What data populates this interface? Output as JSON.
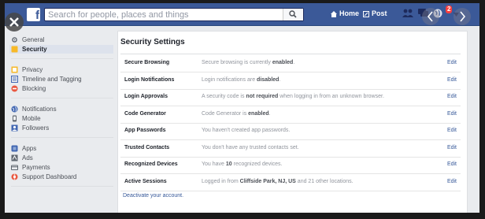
{
  "topbar": {
    "logo": "f",
    "search_placeholder": "Search for people, places and things",
    "home_label": "Home",
    "post_label": "Post",
    "notif_count": "2"
  },
  "sidebar": {
    "groups": [
      [
        {
          "label": "General",
          "icon": "gear-icon"
        },
        {
          "label": "Security",
          "icon": "shield-icon",
          "active": true
        }
      ],
      [
        {
          "label": "Privacy",
          "icon": "privacy-icon"
        },
        {
          "label": "Timeline and Tagging",
          "icon": "timeline-icon"
        },
        {
          "label": "Blocking",
          "icon": "block-icon"
        }
      ],
      [
        {
          "label": "Notifications",
          "icon": "globe-icon"
        },
        {
          "label": "Mobile",
          "icon": "mobile-icon"
        },
        {
          "label": "Followers",
          "icon": "followers-icon"
        }
      ],
      [
        {
          "label": "Apps",
          "icon": "apps-icon"
        },
        {
          "label": "Ads",
          "icon": "ads-icon"
        },
        {
          "label": "Payments",
          "icon": "payments-icon"
        },
        {
          "label": "Support Dashboard",
          "icon": "support-icon"
        }
      ]
    ]
  },
  "main": {
    "title": "Security Settings",
    "rows": [
      {
        "label": "Secure Browsing",
        "desc": [
          [
            "Secure browsing is currently ",
            false
          ],
          [
            "enabled",
            true
          ],
          [
            ".",
            false
          ]
        ],
        "edit": "Edit"
      },
      {
        "label": "Login Notifications",
        "desc": [
          [
            "Login notifications are ",
            false
          ],
          [
            "disabled",
            true
          ],
          [
            ".",
            false
          ]
        ],
        "edit": "Edit"
      },
      {
        "label": "Login Approvals",
        "desc": [
          [
            "A security code is ",
            false
          ],
          [
            "not required",
            true
          ],
          [
            " when logging in from an unknown browser.",
            false
          ]
        ],
        "edit": "Edit"
      },
      {
        "label": "Code Generator",
        "desc": [
          [
            "Code Generator is ",
            false
          ],
          [
            "enabled",
            true
          ],
          [
            ".",
            false
          ]
        ],
        "edit": "Edit"
      },
      {
        "label": "App Passwords",
        "desc": [
          [
            "You haven't created app passwords.",
            false
          ]
        ],
        "edit": "Edit"
      },
      {
        "label": "Trusted Contacts",
        "desc": [
          [
            "You don't have any trusted contacts set.",
            false
          ]
        ],
        "edit": "Edit"
      },
      {
        "label": "Recognized Devices",
        "desc": [
          [
            "You have ",
            false
          ],
          [
            "10",
            true
          ],
          [
            " recognized devices.",
            false
          ]
        ],
        "edit": "Edit"
      },
      {
        "label": "Active Sessions",
        "desc": [
          [
            "Logged in from ",
            false
          ],
          [
            "Cliffside Park, NJ, US",
            true
          ],
          [
            " and 21 other locations.",
            false
          ]
        ],
        "edit": "Edit"
      }
    ],
    "deactivate_link": "Deactivate your account."
  },
  "colors": {
    "brand": "#3b5998",
    "link": "#365899",
    "badge": "#fa3e3e"
  }
}
